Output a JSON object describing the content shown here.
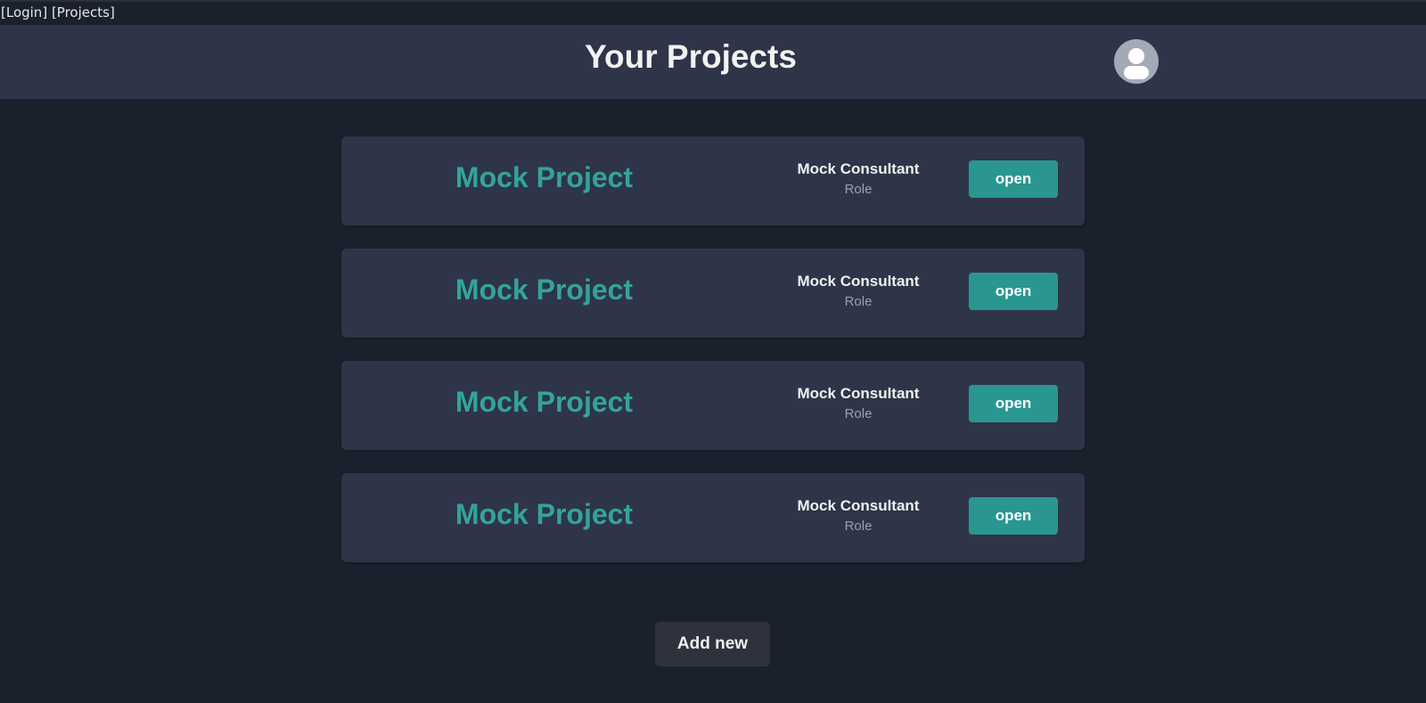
{
  "topnav": {
    "links": [
      {
        "label": "[Login]"
      },
      {
        "label": "[Projects]"
      }
    ]
  },
  "header": {
    "title": "Your Projects",
    "avatar_icon": "user-avatar-icon"
  },
  "projects": [
    {
      "title": "Mock Project",
      "person": "Mock Consultant",
      "role": "Role",
      "action_label": "open"
    },
    {
      "title": "Mock Project",
      "person": "Mock Consultant",
      "role": "Role",
      "action_label": "open"
    },
    {
      "title": "Mock Project",
      "person": "Mock Consultant",
      "role": "Role",
      "action_label": "open"
    },
    {
      "title": "Mock Project",
      "person": "Mock Consultant",
      "role": "Role",
      "action_label": "open"
    }
  ],
  "add_new_label": "Add new",
  "colors": {
    "background": "#1b202d",
    "surface": "#2e3548",
    "accent": "#34a39c",
    "button": "#2a9690",
    "muted_text": "#9aa0ac"
  }
}
